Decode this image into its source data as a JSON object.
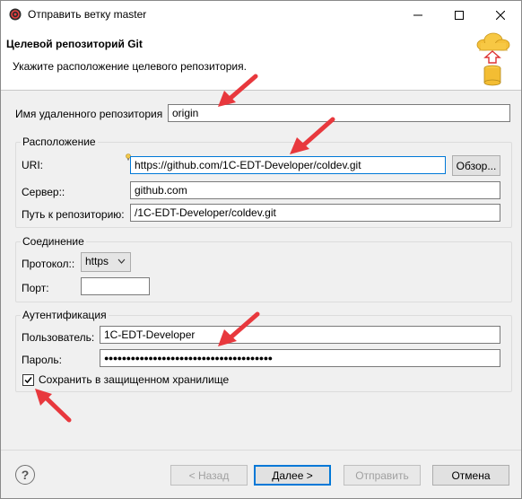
{
  "window": {
    "title": "Отправить ветку master"
  },
  "header": {
    "title": "Целевой репозиторий Git",
    "description": "Укажите расположение целевого репозитория."
  },
  "remote_name": {
    "label": "Имя удаленного репозитория",
    "value": "origin"
  },
  "location": {
    "legend": "Расположение",
    "uri_label": "URI:",
    "uri_value": "https://github.com/1C-EDT-Developer/coldev.git",
    "browse_label": "Обзор...",
    "server_label": "Сервер::",
    "server_value": "github.com",
    "path_label": "Путь к репозиторию:",
    "path_value": "/1C-EDT-Developer/coldev.git"
  },
  "connection": {
    "legend": "Соединение",
    "protocol_label": "Протокол::",
    "protocol_value": "https",
    "port_label": "Порт:",
    "port_value": ""
  },
  "auth": {
    "legend": "Аутентификация",
    "user_label": "Пользователь:",
    "user_value": "1C-EDT-Developer",
    "password_label": "Пароль:",
    "password_value": "●●●●●●●●●●●●●●●●●●●●●●●●●●●●●●●●●●●●●●",
    "save_label": "Сохранить в защищенном хранилище",
    "save_checked": true
  },
  "footer": {
    "help_glyph": "?",
    "back_label": "< Назад",
    "next_label": "Далее >",
    "send_label": "Отправить",
    "cancel_label": "Отмена"
  },
  "colors": {
    "annotation_arrow": "#e8383d",
    "focus": "#0078d7"
  }
}
